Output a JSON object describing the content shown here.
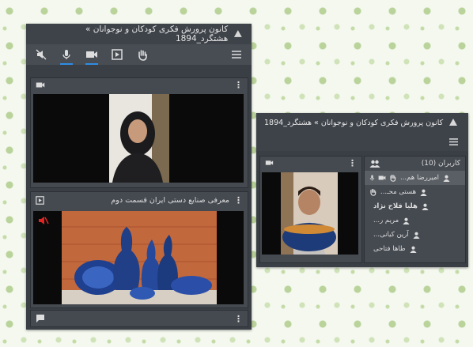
{
  "window_left": {
    "title": "کانون پرورش فکری کودکان و نوجوانان » هشتگرد_1894",
    "toolbar": {
      "icons": [
        "volume-mute-icon",
        "microphone-icon",
        "video-camera-icon",
        "screen-share-icon",
        "raise-hand-icon",
        "menu-icon"
      ]
    },
    "video_panel": {
      "header_icon": "video-camera-icon"
    },
    "presentation_panel": {
      "title": "معرفی صنایع دستی ایران قسمت دوم"
    },
    "chat_panel": {
      "header_icon": "chat-icon"
    }
  },
  "window_right": {
    "title": "کانون پرورش فکری کودکان و نوجوانان » هشتگرد_1894",
    "users_panel": {
      "title": "کاربران (10)",
      "users": [
        {
          "name": "امیررضا هم...",
          "mic": true,
          "cam": true,
          "hand": true
        },
        {
          "name": "هستی محـ...",
          "mic": false,
          "cam": false,
          "hand": true
        },
        {
          "name": "هلیا فلاح نژاد",
          "mic": false,
          "cam": false,
          "hand": false
        },
        {
          "name": "مریم ر...",
          "mic": false,
          "cam": false,
          "hand": false
        },
        {
          "name": "آرین کیانی...",
          "mic": false,
          "cam": false,
          "hand": false
        },
        {
          "name": "طاها فتاحی",
          "mic": false,
          "cam": false,
          "hand": false
        }
      ]
    }
  }
}
